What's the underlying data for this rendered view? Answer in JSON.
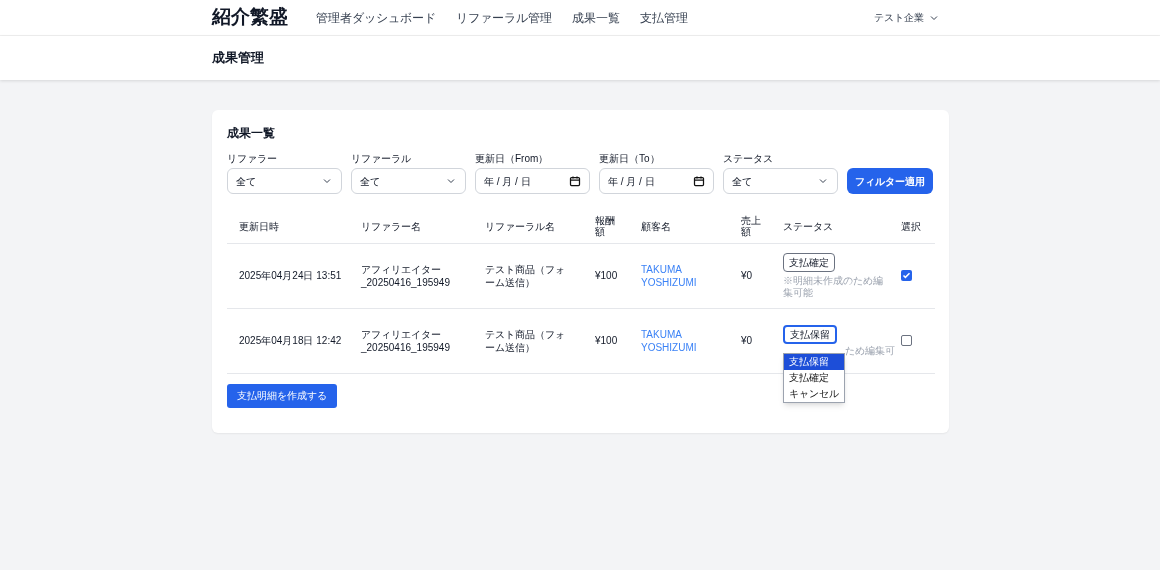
{
  "brand": "紹介繁盛",
  "nav": [
    {
      "label": "管理者ダッシュボード"
    },
    {
      "label": "リファーラル管理"
    },
    {
      "label": "成果一覧"
    },
    {
      "label": "支払管理"
    }
  ],
  "account": {
    "label": "テスト企業"
  },
  "page_title": "成果管理",
  "card_title": "成果一覧",
  "filters": [
    {
      "kind": "select",
      "label": "リファラー",
      "value": "全て"
    },
    {
      "kind": "select",
      "label": "リファーラル",
      "value": "全て"
    },
    {
      "kind": "date",
      "label": "更新日（From）",
      "value": "年 / 月 / 日"
    },
    {
      "kind": "date",
      "label": "更新日（To）",
      "value": "年 / 月 / 日"
    },
    {
      "kind": "select",
      "label": "ステータス",
      "value": "全て"
    }
  ],
  "filter_button": "フィルター適用",
  "table": {
    "columns": [
      "更新日時",
      "リファラー名",
      "リファーラル名",
      "報酬額",
      "顧客名",
      "売上額",
      "ステータス",
      "選択"
    ],
    "rows": [
      {
        "updated": "2025年04月24日 13:51",
        "referrer": "アフィリエイター_20250416_195949",
        "referral": "テスト商品（フォーム送信）",
        "reward": "¥100",
        "customer": "TAKUMA YOSHIZUMI",
        "sales": "¥0",
        "status": "支払確定",
        "note": "※明細未作成のため編集可能",
        "open": false,
        "checked": true
      },
      {
        "updated": "2025年04月18日 12:42",
        "referrer": "アフィリエイター_20250416_195949",
        "referral": "テスト商品（フォーム送信）",
        "reward": "¥100",
        "customer": "TAKUMA YOSHIZUMI",
        "sales": "¥0",
        "status": "支払保留",
        "note": "ため編集可",
        "open": true,
        "options": [
          {
            "label": "支払保留",
            "selected": true
          },
          {
            "label": "支払確定",
            "selected": false
          },
          {
            "label": "キャンセル",
            "selected": false
          }
        ],
        "checked": false
      }
    ]
  },
  "create_button": "支払明細を作成する"
}
